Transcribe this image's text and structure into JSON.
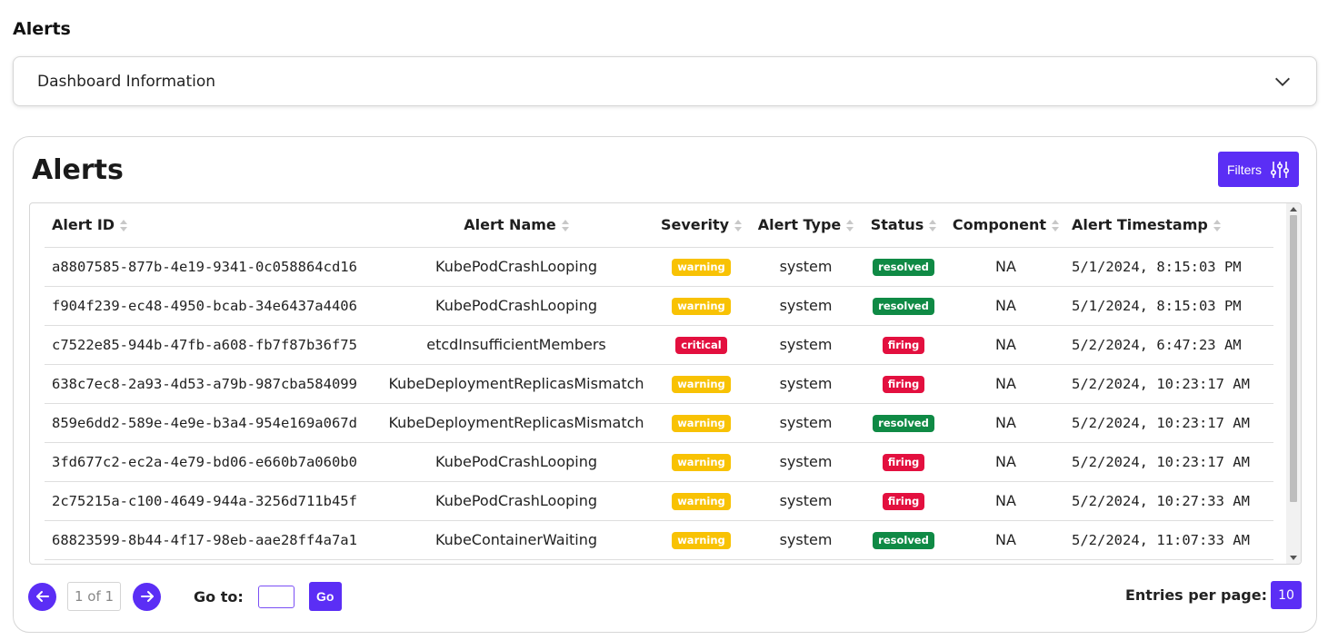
{
  "page": {
    "title": "Alerts"
  },
  "dashboard_info": {
    "label": "Dashboard Information"
  },
  "card": {
    "title": "Alerts",
    "filters_label": "Filters"
  },
  "table": {
    "columns": [
      "Alert ID",
      "Alert Name",
      "Severity",
      "Alert Type",
      "Status",
      "Component",
      "Alert Timestamp"
    ],
    "rows": [
      {
        "id": "a8807585-877b-4e19-9341-0c058864cd16",
        "name": "KubePodCrashLooping",
        "severity": "warning",
        "type": "system",
        "status": "resolved",
        "component": "NA",
        "timestamp": "5/1/2024, 8:15:03 PM"
      },
      {
        "id": "f904f239-ec48-4950-bcab-34e6437a4406",
        "name": "KubePodCrashLooping",
        "severity": "warning",
        "type": "system",
        "status": "resolved",
        "component": "NA",
        "timestamp": "5/1/2024, 8:15:03 PM"
      },
      {
        "id": "c7522e85-944b-47fb-a608-fb7f87b36f75",
        "name": "etcdInsufficientMembers",
        "severity": "critical",
        "type": "system",
        "status": "firing",
        "component": "NA",
        "timestamp": "5/2/2024, 6:47:23 AM"
      },
      {
        "id": "638c7ec8-2a93-4d53-a79b-987cba584099",
        "name": "KubeDeploymentReplicasMismatch",
        "severity": "warning",
        "type": "system",
        "status": "firing",
        "component": "NA",
        "timestamp": "5/2/2024, 10:23:17 AM"
      },
      {
        "id": "859e6dd2-589e-4e9e-b3a4-954e169a067d",
        "name": "KubeDeploymentReplicasMismatch",
        "severity": "warning",
        "type": "system",
        "status": "resolved",
        "component": "NA",
        "timestamp": "5/2/2024, 10:23:17 AM"
      },
      {
        "id": "3fd677c2-ec2a-4e79-bd06-e660b7a060b0",
        "name": "KubePodCrashLooping",
        "severity": "warning",
        "type": "system",
        "status": "firing",
        "component": "NA",
        "timestamp": "5/2/2024, 10:23:17 AM"
      },
      {
        "id": "2c75215a-c100-4649-944a-3256d711b45f",
        "name": "KubePodCrashLooping",
        "severity": "warning",
        "type": "system",
        "status": "firing",
        "component": "NA",
        "timestamp": "5/2/2024, 10:27:33 AM"
      },
      {
        "id": "68823599-8b44-4f17-98eb-aae28ff4a7a1",
        "name": "KubeContainerWaiting",
        "severity": "warning",
        "type": "system",
        "status": "resolved",
        "component": "NA",
        "timestamp": "5/2/2024, 11:07:33 AM"
      }
    ]
  },
  "pagination": {
    "page_indicator": "1 of 1",
    "goto_label": "Go to:",
    "go_label": "Go",
    "entries_label": "Entries per page:",
    "entries_value": "10"
  },
  "icons": {
    "prev": "arrow-left-icon",
    "next": "arrow-right-icon",
    "filters": "sliders-icon",
    "expand": "chevron-down-icon"
  },
  "colors": {
    "accent": "#5b2ef5",
    "warning": "#f8c204",
    "critical": "#e3103f",
    "resolved": "#0f8a45",
    "firing": "#e3103f"
  }
}
